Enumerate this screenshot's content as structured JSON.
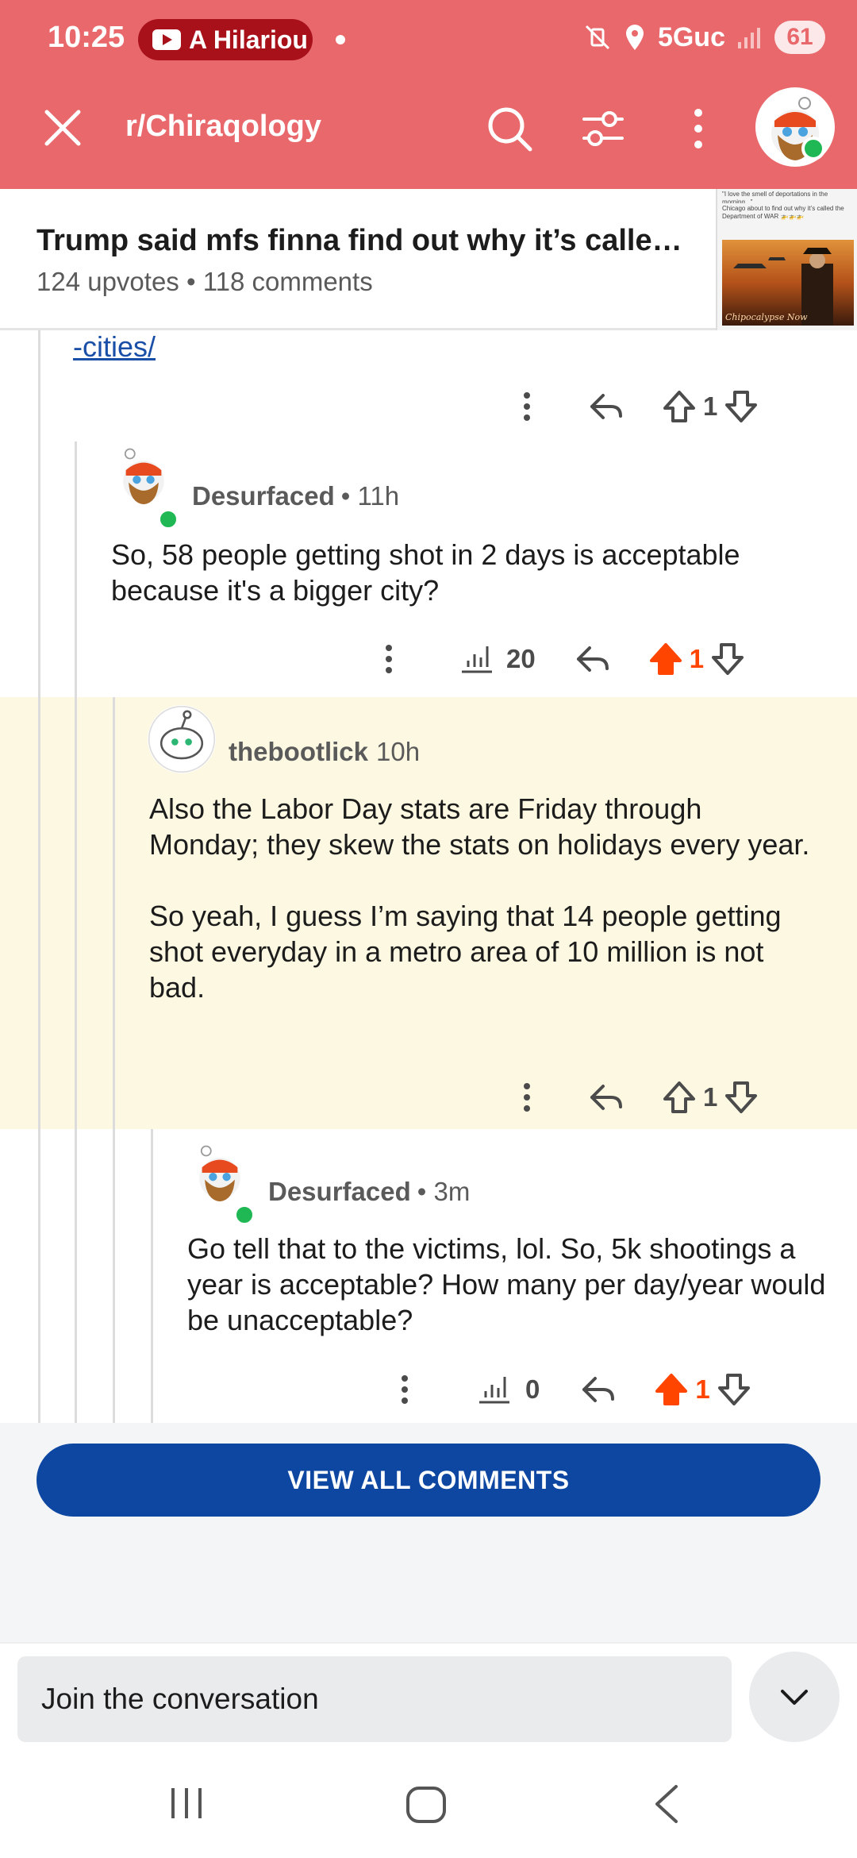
{
  "status_bar": {
    "time": "10:25",
    "notification_pill": "A Hilariou",
    "network": "5Guc",
    "battery": "61"
  },
  "header": {
    "subreddit": "r/Chiraqology"
  },
  "post": {
    "title": "Trump said mfs finna find out why it’s called...",
    "upvotes": "124 upvotes",
    "comments": "118 comments",
    "thumb_caption_1": "\"I love the smell of deportations in the morning...\"",
    "thumb_caption_2": "Chicago about to find out why it’s called the Department of WAR 🚁🚁🚁",
    "thumb_logo": "Chipocalypse Now"
  },
  "thread": {
    "link_fragment": "-cities/",
    "top_actions": {
      "score": "1"
    },
    "comments": [
      {
        "username": "Desurfaced",
        "time": "• 11h",
        "body": "So, 58 people getting shot in 2 days is acceptable because it's a bigger city?",
        "views": "20",
        "score": "1"
      },
      {
        "username": "thebootlick",
        "time": "10h",
        "body_p1": "Also the Labor Day stats are Friday through Monday; they skew the stats on holidays every year.",
        "body_p2": "So yeah, I guess I’m saying that 14 people getting shot everyday in a metro area of 10 million is not bad.",
        "score": "1"
      },
      {
        "username": "Desurfaced",
        "time": "• 3m",
        "body": "Go tell that to the victims, lol. So, 5k shootings a year is acceptable? How many per day/year would be unacceptable?",
        "views": "0",
        "score": "1"
      }
    ]
  },
  "footer": {
    "view_all": "VIEW ALL COMMENTS",
    "compose_placeholder": "Join the conversation"
  },
  "colors": {
    "header_red": "#e8686b",
    "upvote_orange": "#ff4500",
    "button_blue": "#0d47a1",
    "highlight": "#fdf8e1"
  }
}
